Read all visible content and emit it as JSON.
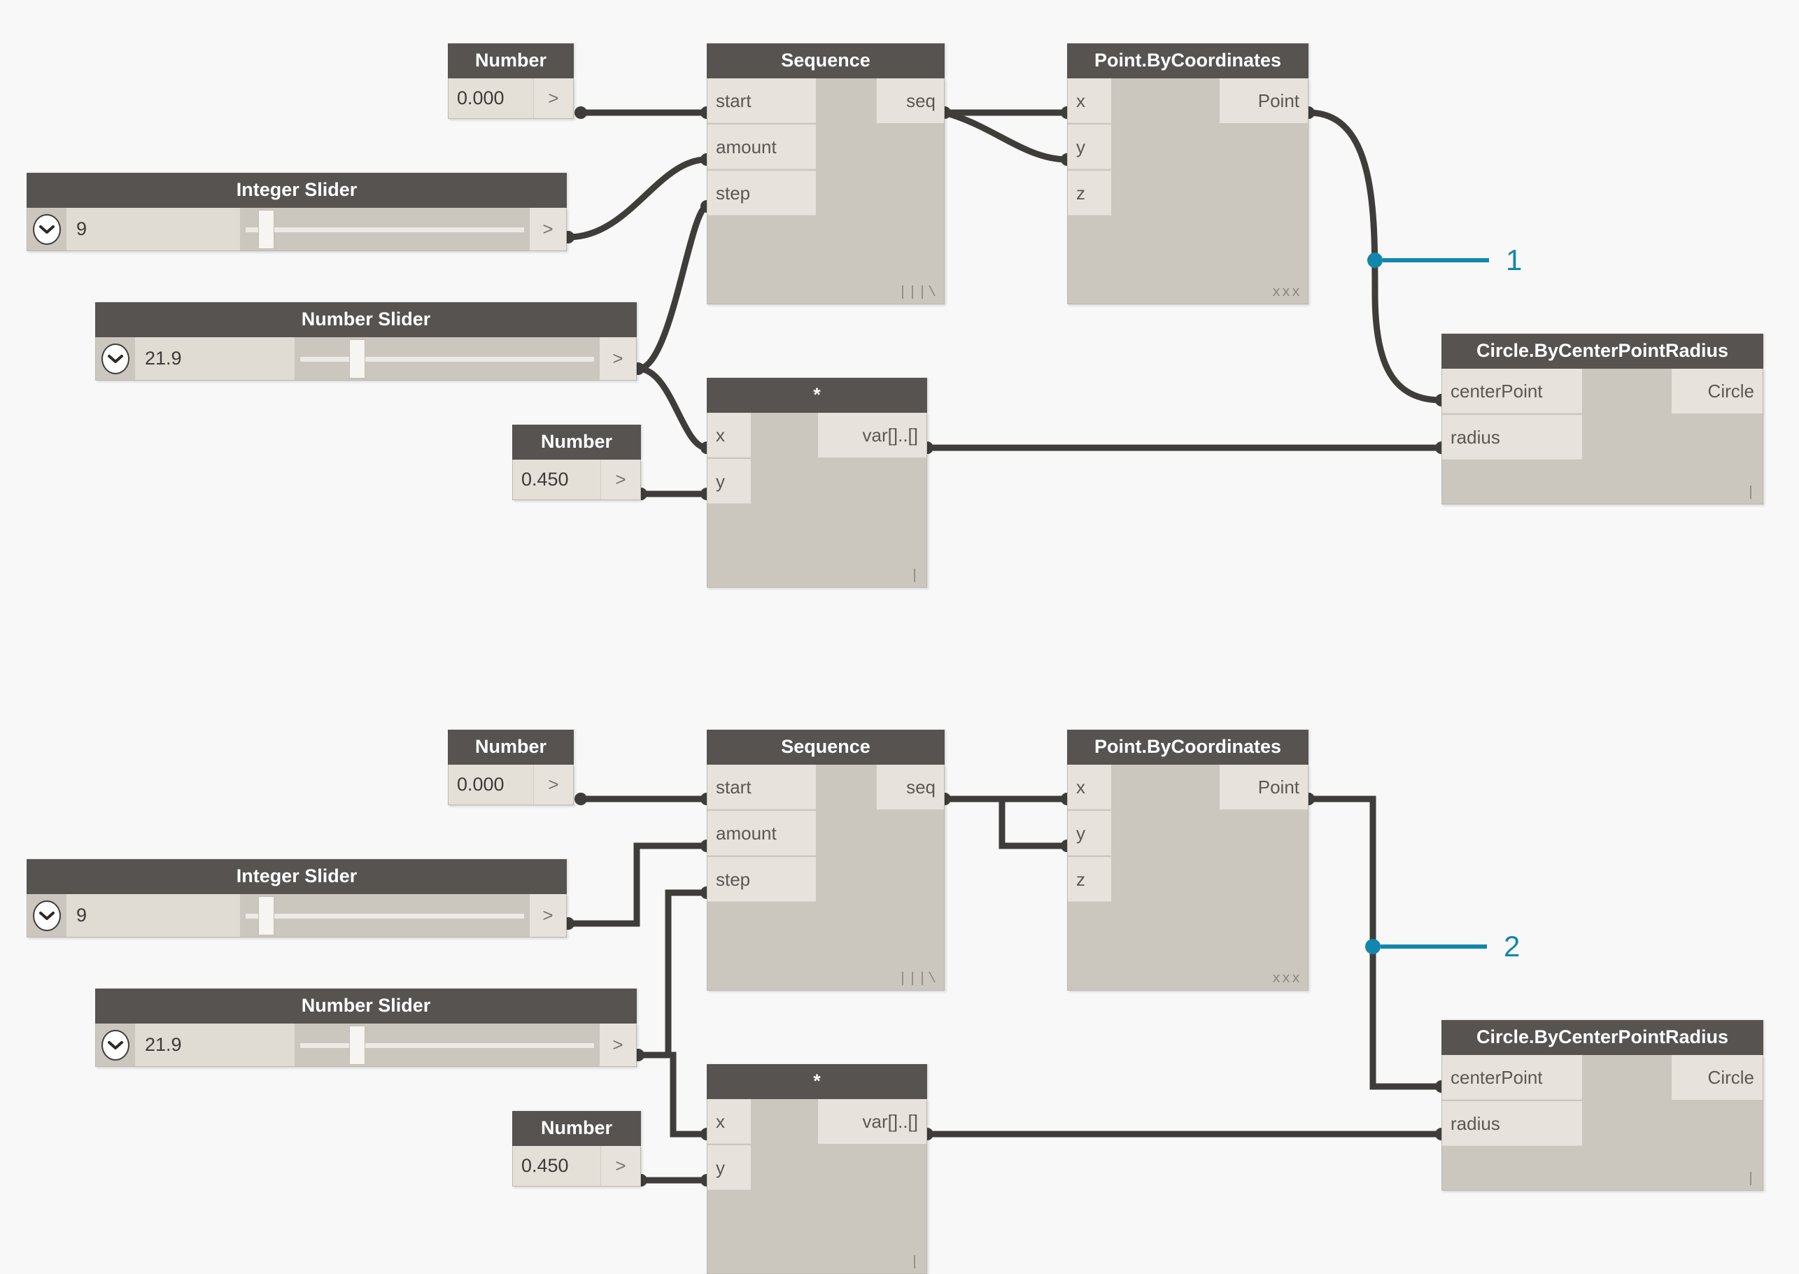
{
  "app": {
    "canvas_background": "#f8f8f8",
    "node_header_color": "#565350",
    "node_body_color": "#cbc7bf",
    "port_color": "#e7e3dc",
    "wire_color": "#3f3d3a",
    "annotation_color": "#1386ab"
  },
  "graphs": [
    {
      "id": "graph-top",
      "wire_style": "curved",
      "annotation": {
        "label": "1"
      },
      "nodes": {
        "number_start": {
          "title": "Number",
          "value": "0.000",
          "output_port_label": ">"
        },
        "integer_slider": {
          "title": "Integer Slider",
          "value": "9",
          "output_port_label": ">",
          "expand_icon": "chevron-down-icon",
          "slider_fraction": 0.11
        },
        "number_slider": {
          "title": "Number Slider",
          "value": "21.9",
          "output_port_label": ">",
          "expand_icon": "chevron-down-icon",
          "slider_fraction": 0.24
        },
        "number_factor": {
          "title": "Number",
          "value": "0.450",
          "output_port_label": ">"
        },
        "sequence": {
          "title": "Sequence",
          "inputs": [
            "start",
            "amount",
            "step"
          ],
          "outputs": [
            "seq"
          ],
          "lacing": "|||\\"
        },
        "point_bycoordinates": {
          "title": "Point.ByCoordinates",
          "inputs": [
            "x",
            "y",
            "z"
          ],
          "outputs": [
            "Point"
          ],
          "lacing": "xxx"
        },
        "multiply": {
          "title": "*",
          "inputs": [
            "x",
            "y"
          ],
          "outputs": [
            "var[]..[]"
          ],
          "lacing": "|"
        },
        "circle_bycenterpointradius": {
          "title": "Circle.ByCenterPointRadius",
          "inputs": [
            "centerPoint",
            "radius"
          ],
          "outputs": [
            "Circle"
          ],
          "lacing": "|"
        }
      }
    },
    {
      "id": "graph-bottom",
      "wire_style": "orthogonal",
      "annotation": {
        "label": "2"
      },
      "nodes": {
        "number_start": {
          "title": "Number",
          "value": "0.000",
          "output_port_label": ">"
        },
        "integer_slider": {
          "title": "Integer Slider",
          "value": "9",
          "output_port_label": ">",
          "expand_icon": "chevron-down-icon",
          "slider_fraction": 0.11
        },
        "number_slider": {
          "title": "Number Slider",
          "value": "21.9",
          "output_port_label": ">",
          "expand_icon": "chevron-down-icon",
          "slider_fraction": 0.24
        },
        "number_factor": {
          "title": "Number",
          "value": "0.450",
          "output_port_label": ">"
        },
        "sequence": {
          "title": "Sequence",
          "inputs": [
            "start",
            "amount",
            "step"
          ],
          "outputs": [
            "seq"
          ],
          "lacing": "|||\\"
        },
        "point_bycoordinates": {
          "title": "Point.ByCoordinates",
          "inputs": [
            "x",
            "y",
            "z"
          ],
          "outputs": [
            "Point"
          ],
          "lacing": "xxx"
        },
        "multiply": {
          "title": "*",
          "inputs": [
            "x",
            "y"
          ],
          "outputs": [
            "var[]..[]"
          ],
          "lacing": "|"
        },
        "circle_bycenterpointradius": {
          "title": "Circle.ByCenterPointRadius",
          "inputs": [
            "centerPoint",
            "radius"
          ],
          "outputs": [
            "Circle"
          ],
          "lacing": "|"
        }
      }
    }
  ]
}
